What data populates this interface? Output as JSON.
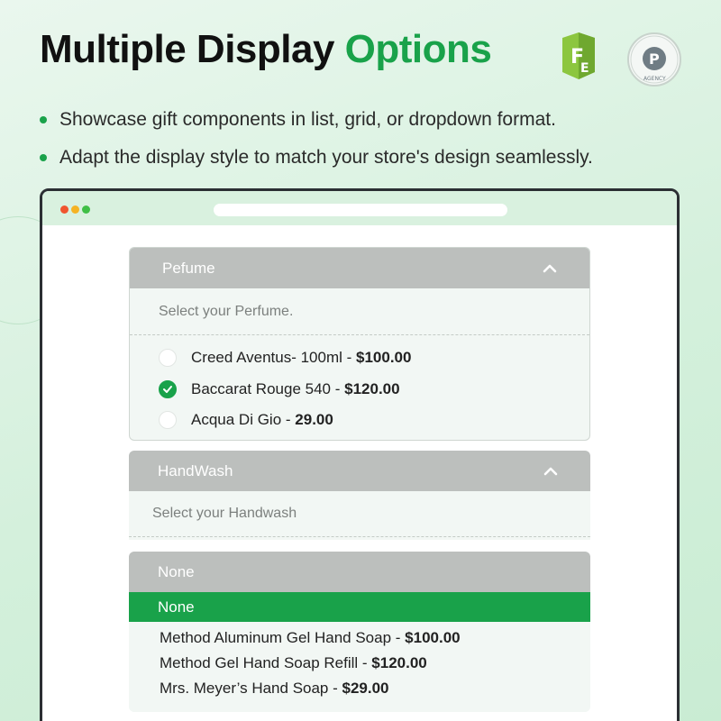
{
  "headline": {
    "main": "Multiple Display ",
    "accent": "Options"
  },
  "logos": {
    "fme_icon": "fme-logo-icon",
    "badge_icon": "prestashop-partner-badge-icon",
    "badge_text": "PRESTASHOP PARTNER AGENCY"
  },
  "colors": {
    "accent": "#19a24a",
    "header_gray": "#bcbfbd",
    "window_border": "#2b2f33"
  },
  "bullets": [
    "Showcase gift components in list, grid, or dropdown format.",
    "Adapt the display style to match your store's design seamlessly."
  ],
  "perfume": {
    "title": "Pefume",
    "placeholder": "Select your Perfume.",
    "options": [
      {
        "name": "Creed Aventus- 100ml - ",
        "price": "$100.00",
        "checked": false
      },
      {
        "name": "Baccarat Rouge 540 - ",
        "price": "$120.00",
        "checked": true
      },
      {
        "name": "Acqua Di Gio - ",
        "price": "29.00",
        "checked": false
      }
    ]
  },
  "handwash": {
    "title": "HandWash",
    "placeholder": "Select your Handwash",
    "selected": "None",
    "options": [
      {
        "name": "None",
        "price": "",
        "highlighted": true
      },
      {
        "name": "Method Aluminum Gel Hand Soap - ",
        "price": "$100.00"
      },
      {
        "name": "Method Gel Hand Soap Refill - ",
        "price": "$120.00"
      },
      {
        "name": "Mrs. Meyer’s Hand Soap - ",
        "price": "$29.00"
      }
    ]
  }
}
